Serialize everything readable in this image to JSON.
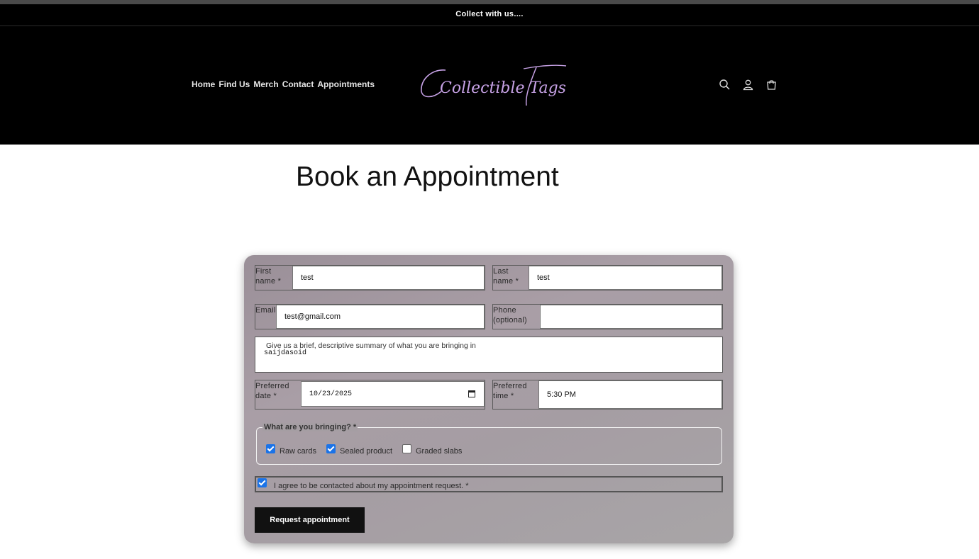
{
  "announcement": "Collect with us....",
  "nav": [
    "Home",
    "Find Us",
    "Merch",
    "Contact",
    "Appointments"
  ],
  "brand": {
    "logo_text": "Collectible Tags",
    "logo_color": "#c7a2e6"
  },
  "header_icons": [
    "search-icon",
    "account-icon",
    "cart-icon"
  ],
  "page_title": "Book an Appointment",
  "form": {
    "first_name": {
      "label": "First name *",
      "value": "test"
    },
    "last_name": {
      "label": "Last name *",
      "value": "test"
    },
    "email": {
      "label": "Email",
      "value": "test@gmail.com"
    },
    "phone": {
      "label": "Phone (optional)",
      "value": ""
    },
    "summary": {
      "placeholder": "Give us a brief, descriptive summary of what you are bringing in",
      "value": "saijdasoid"
    },
    "date": {
      "label": "Preferred date *",
      "value": "10/23/2025"
    },
    "time": {
      "label": "Preferred time *",
      "value": "5:30 PM"
    },
    "bringing": {
      "legend": "What are you bringing? *",
      "options": [
        {
          "label": "Raw cards",
          "checked": true
        },
        {
          "label": "Sealed product",
          "checked": true
        },
        {
          "label": "Graded slabs",
          "checked": false
        }
      ]
    },
    "agree": {
      "label": "I agree to be contacted about my appointment request. *",
      "checked": true
    },
    "submit_label": "Request appointment"
  },
  "colors": {
    "header_bg": "#000000",
    "button_bg": "#111111",
    "checkbox_accent": "#1a73e8"
  }
}
